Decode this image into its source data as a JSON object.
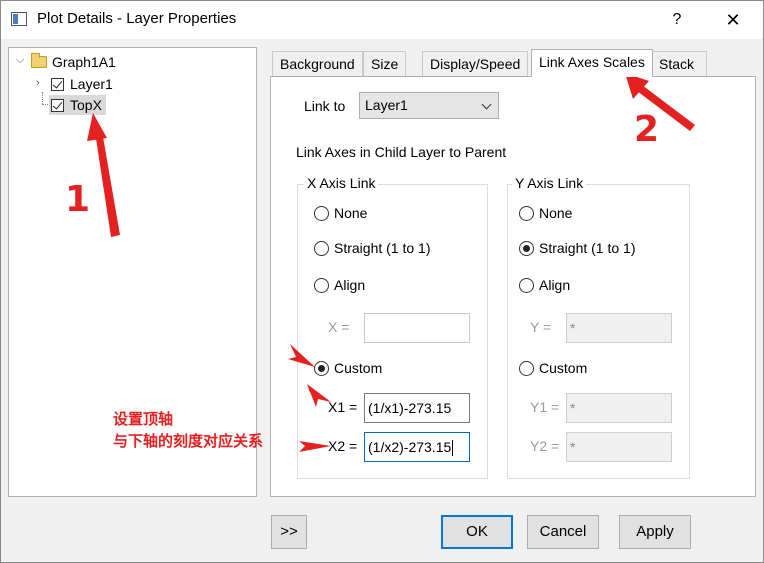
{
  "window": {
    "title": "Plot Details - Layer Properties",
    "help_label": "?",
    "close_label": "✕"
  },
  "tree": {
    "root": "Graph1A1",
    "items": [
      {
        "label": "Layer1",
        "checked": true
      },
      {
        "label": "TopX",
        "checked": true,
        "selected": true
      }
    ]
  },
  "tabs": [
    {
      "label": "Background"
    },
    {
      "label": "Size"
    },
    {
      "label": "Display/Speed"
    },
    {
      "label": "Link Axes Scales",
      "active": true
    },
    {
      "label": "Stack"
    }
  ],
  "link": {
    "label": "Link to",
    "value": "Layer1",
    "section_title": "Link Axes in Child Layer to Parent"
  },
  "x_axis": {
    "title": "X Axis Link",
    "options": [
      "None",
      "Straight (1 to 1)",
      "Align",
      "Custom"
    ],
    "selected": "Custom",
    "x_label": "X =",
    "x_value": "",
    "x1_label": "X1 =",
    "x1_value": "(1/x1)-273.15",
    "x2_label": "X2 =",
    "x2_value": "(1/x2)-273.15"
  },
  "y_axis": {
    "title": "Y Axis Link",
    "options": [
      "None",
      "Straight (1 to 1)",
      "Align",
      "Custom"
    ],
    "selected": "Straight (1 to 1)",
    "y_label": "Y =",
    "y_value": "*",
    "y1_label": "Y1 =",
    "y1_value": "*",
    "y2_label": "Y2 =",
    "y2_value": "*"
  },
  "buttons": {
    "expand": ">>",
    "ok": "OK",
    "cancel": "Cancel",
    "apply": "Apply"
  },
  "annotations": {
    "num1": "1",
    "num2": "2",
    "note_line1": "设置顶轴",
    "note_line2": "与下轴的刻度对应关系",
    "color": "#e42020"
  }
}
